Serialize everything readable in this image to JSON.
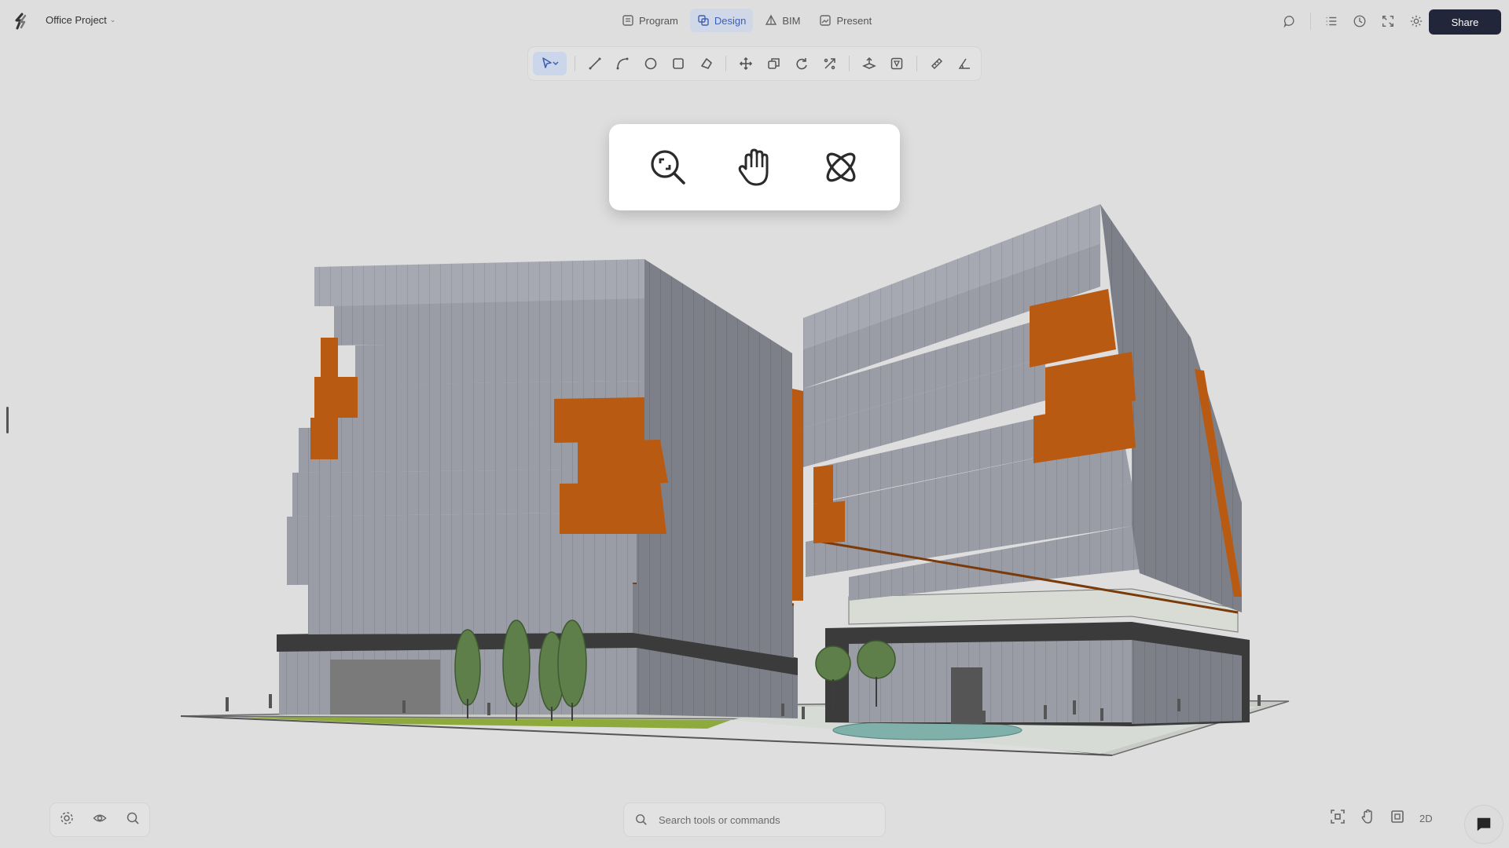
{
  "app": {
    "project_name": "Office Project",
    "logo_icon": "app-logo-icon"
  },
  "modes": [
    {
      "label": "Program",
      "icon": "program-icon",
      "active": false
    },
    {
      "label": "Design",
      "icon": "design-icon",
      "active": true
    },
    {
      "label": "BIM",
      "icon": "bim-icon",
      "active": false
    },
    {
      "label": "Present",
      "icon": "present-icon",
      "active": false
    }
  ],
  "header_actions": {
    "icons": [
      "comment-icon",
      "list-icon",
      "history-icon",
      "fullscreen-icon",
      "settings-icon"
    ],
    "share_label": "Share"
  },
  "toolbar": {
    "tools": [
      "select-tool-icon",
      "line-tool-icon",
      "arc-tool-icon",
      "circle-tool-icon",
      "rectangle-tool-icon",
      "polygon-tool-icon",
      "move-tool-icon",
      "copy-tool-icon",
      "rotate-tool-icon",
      "scale-tool-icon",
      "extrude-tool-icon",
      "section-tool-icon",
      "measure-tool-icon",
      "angle-tool-icon"
    ],
    "active_tool": "select-tool-icon"
  },
  "navigation_popup": {
    "icons": [
      "zoom-extents-icon",
      "pan-hand-icon",
      "orbit-icon"
    ]
  },
  "bottom_left": {
    "icons": [
      "settings-icon",
      "visibility-icon",
      "zoom-icon"
    ]
  },
  "search": {
    "placeholder": "Search tools or commands"
  },
  "bottom_right": {
    "icons": [
      "fit-view-icon",
      "pan-icon",
      "frame-icon"
    ],
    "view_mode_label": "2D"
  },
  "colors": {
    "background": "#dedede",
    "accent": "#3f5fb3",
    "share_button": "#22263a",
    "facade_gray": "#9a9ca6",
    "facade_orange": "#b85a12",
    "base_dark": "#3b3b3b"
  }
}
